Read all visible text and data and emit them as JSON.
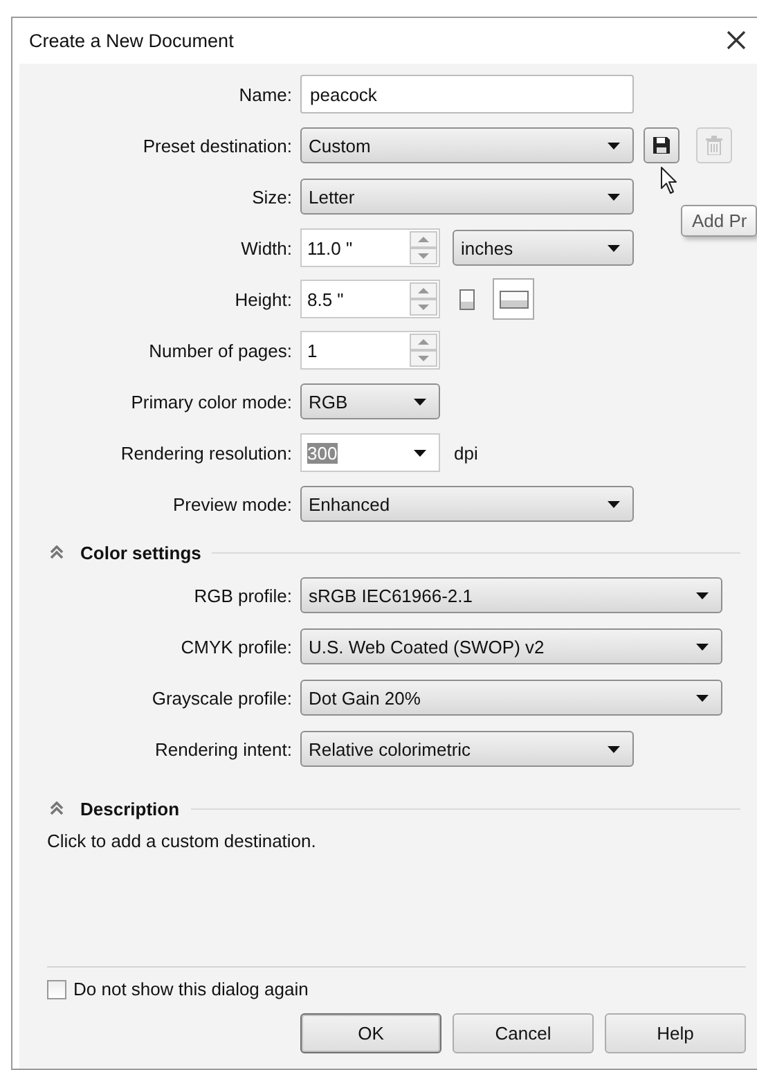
{
  "window": {
    "title": "Create a New Document"
  },
  "fields": [
    {
      "kind": "text",
      "label": "Name:",
      "value": "peacock"
    },
    {
      "kind": "select",
      "label": "Preset destination:",
      "value": "Custom",
      "actions": [
        {
          "kind": "save",
          "disabled": false
        },
        {
          "kind": "delete",
          "disabled": true
        }
      ]
    },
    {
      "kind": "select",
      "label": "Size:",
      "value": "Letter"
    },
    {
      "kind": "spin",
      "label": "Width:",
      "value": "11.0 \"",
      "unit": "inches"
    },
    {
      "kind": "spin",
      "label": "Height:",
      "value": "8.5 \"",
      "orientations": [
        {
          "kind": "portrait",
          "selected": false
        },
        {
          "kind": "landscape",
          "selected": true
        }
      ]
    },
    {
      "kind": "spin",
      "label": "Number of pages:",
      "value": "1"
    },
    {
      "kind": "select",
      "label": "Primary color mode:",
      "value": "RGB"
    },
    {
      "kind": "combo",
      "label": "Rendering resolution:",
      "value": "300",
      "highlighted": true,
      "suffix": "dpi"
    },
    {
      "kind": "select",
      "label": "Preview mode:",
      "value": "Enhanced"
    }
  ],
  "color_settings": {
    "title": "Color settings",
    "expanded": true,
    "fields": [
      {
        "kind": "select",
        "label": "RGB profile:",
        "value": "sRGB IEC61966-2.1"
      },
      {
        "kind": "select",
        "label": "CMYK profile:",
        "value": "U.S. Web Coated (SWOP) v2"
      },
      {
        "kind": "select",
        "label": "Grayscale profile:",
        "value": "Dot Gain 20%"
      },
      {
        "kind": "select",
        "label": "Rendering intent:",
        "value": "Relative colorimetric"
      }
    ]
  },
  "description": {
    "title": "Description",
    "expanded": true,
    "text": "Click to add a custom destination."
  },
  "checkbox": {
    "label": "Do not show this dialog again",
    "checked": false
  },
  "buttons": [
    {
      "label": "OK",
      "default": true
    },
    {
      "label": "Cancel",
      "default": false
    },
    {
      "label": "Help",
      "default": false
    }
  ],
  "tooltip": {
    "text": "Add Pr"
  }
}
